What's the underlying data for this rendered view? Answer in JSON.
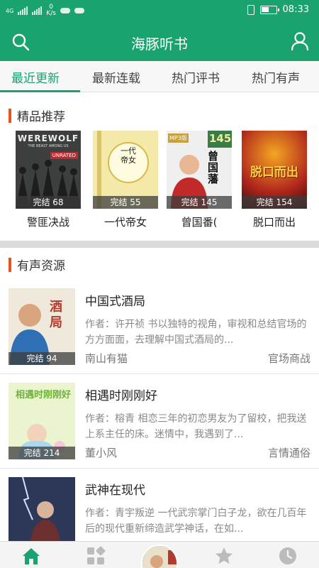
{
  "status_bar": {
    "network": "4G",
    "net_speed_value": "0",
    "net_speed_unit": "K/s",
    "time": "08:33",
    "battery_level": 0.55
  },
  "app_bar": {
    "title": "海豚听书",
    "left_icon": "search-icon",
    "right_icon": "user-icon"
  },
  "tabs": [
    "最近更新",
    "最新连载",
    "热门评书",
    "热门有声"
  ],
  "active_tab": 0,
  "recommend": {
    "title": "精品推荐",
    "books": [
      {
        "name": "警匪决战",
        "status": "完结 68",
        "cover_text": "WEREWOLF",
        "cover_sub": "THE BEAST AMONG US",
        "cover_tag": "UNRATED"
      },
      {
        "name": "一代帝女",
        "status": "完结 55",
        "cover_text": "一代帝女"
      },
      {
        "name": "曾国番(",
        "status": "完结 145",
        "cover_text": "曾国藩",
        "cover_tag": "MP3版",
        "cover_num": "145"
      },
      {
        "name": "脱口而出",
        "status": "完结 154",
        "cover_text": "脱口而出"
      }
    ]
  },
  "audio": {
    "title": "有声资源",
    "items": [
      {
        "title": "中国式酒局",
        "desc": "作者：许开祯 书以独特的视角，审视和总结官场的方方面面，去理解中国式酒局的...",
        "author": "南山有猫",
        "category": "官场商战",
        "status": "完结 94",
        "cover_text": "酒局"
      },
      {
        "title": "相遇时刚刚好",
        "desc": "作者：榕青 相恋三年的初恋男友为了留校，把我送上系主任的床。迷情中，我遇到了...",
        "author": "董小风",
        "category": "言情通俗",
        "status": "完结 214",
        "cover_text": "相遇时刚刚好"
      },
      {
        "title": "武神在现代",
        "desc": "作者：青宇叛逆 一代武宗掌门白子龙，欲在几百年后的现代重新缔造武学神话，在如...",
        "author": "",
        "category": "",
        "status": "",
        "cover_text": ""
      }
    ]
  },
  "bottom_nav": [
    "home-icon",
    "category-icon",
    "player-avatar",
    "star-icon",
    "history-icon"
  ],
  "colors": {
    "brand": "#1aa36f",
    "accent_bar": "#e8541f"
  }
}
